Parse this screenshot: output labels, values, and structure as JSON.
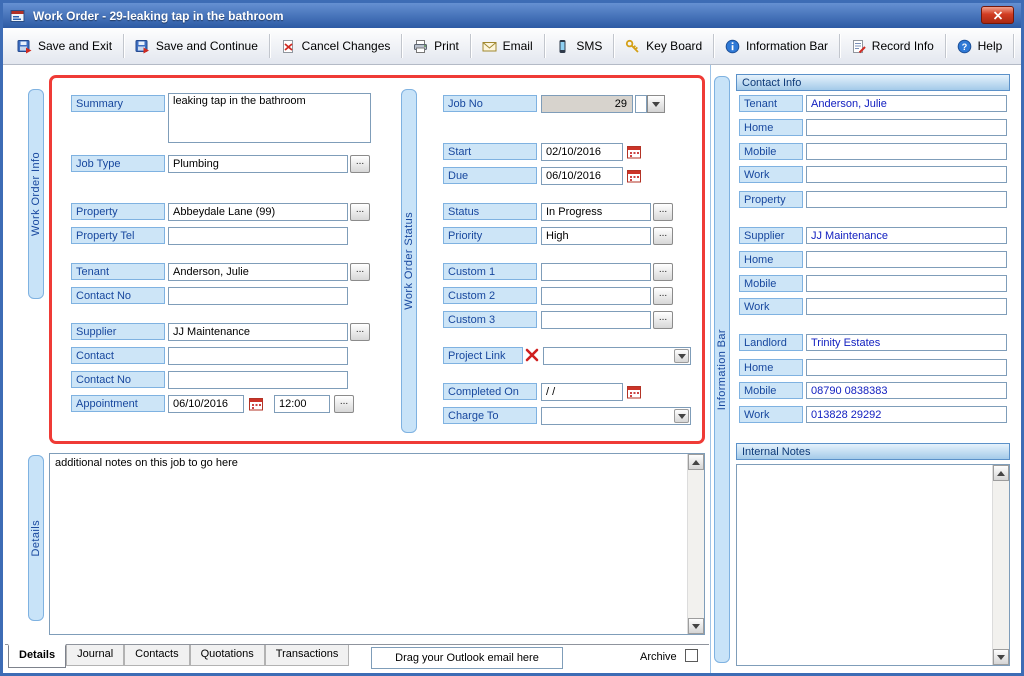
{
  "window": {
    "title": "Work Order -  29-leaking tap in the bathroom"
  },
  "toolbar": {
    "buttons": [
      {
        "label": "Save and Exit"
      },
      {
        "label": "Save and Continue"
      },
      {
        "label": "Cancel Changes"
      },
      {
        "label": "Print"
      },
      {
        "label": "Email"
      },
      {
        "label": "SMS"
      },
      {
        "label": "Key Board"
      },
      {
        "label": "Information Bar"
      },
      {
        "label": "Record Info"
      },
      {
        "label": "Help"
      }
    ]
  },
  "side_tabs": {
    "work_order_info": "Work Order Info",
    "work_order_status": "Work Order Status",
    "details": "Details",
    "information_bar": "Information Bar"
  },
  "work_order_info": {
    "summary_label": "Summary",
    "summary_value": "leaking tap in the bathroom",
    "job_type_label": "Job Type",
    "job_type_value": "Plumbing",
    "property_label": "Property",
    "property_value": "Abbeydale Lane (99)",
    "property_tel_label": "Property Tel",
    "property_tel_value": "",
    "tenant_label": "Tenant",
    "tenant_value": "Anderson, Julie",
    "tenant_contact_no_label": "Contact No",
    "tenant_contact_no_value": "",
    "supplier_label": "Supplier",
    "supplier_value": "JJ Maintenance",
    "contact_label": "Contact",
    "contact_value": "",
    "contact_no_label": "Contact No",
    "contact_no_value": "",
    "appointment_label": "Appointment",
    "appointment_date": "06/10/2016",
    "appointment_time": "12:00"
  },
  "work_order_status": {
    "job_no_label": "Job No",
    "job_no_value": "29",
    "start_label": "Start",
    "start_value": "02/10/2016",
    "due_label": "Due",
    "due_value": "06/10/2016",
    "status_label": "Status",
    "status_value": "In Progress",
    "priority_label": "Priority",
    "priority_value": "High",
    "custom1_label": "Custom 1",
    "custom1_value": "",
    "custom2_label": "Custom 2",
    "custom2_value": "",
    "custom3_label": "Custom 3",
    "custom3_value": "",
    "project_link_label": "Project Link",
    "project_link_value": "",
    "completed_on_label": "Completed On",
    "completed_on_value": "/ /",
    "charge_to_label": "Charge To",
    "charge_to_value": ""
  },
  "details": {
    "notes": "additional notes on this job to go here"
  },
  "bottom_bar": {
    "tabs": [
      {
        "label": "Details"
      },
      {
        "label": "Journal"
      },
      {
        "label": "Contacts"
      },
      {
        "label": "Quotations"
      },
      {
        "label": "Transactions"
      }
    ],
    "active_tab": "Details",
    "outlook_hint": "Drag your Outlook email here",
    "archive_label": "Archive"
  },
  "contact_info": {
    "header": "Contact Info",
    "rows": [
      {
        "label": "Tenant",
        "value": "Anderson, Julie"
      },
      {
        "label": "Home",
        "value": ""
      },
      {
        "label": "Mobile",
        "value": ""
      },
      {
        "label": "Work",
        "value": ""
      },
      {
        "label": "Property",
        "value": ""
      },
      {
        "label": "Supplier",
        "value": "JJ Maintenance"
      },
      {
        "label": "Home",
        "value": ""
      },
      {
        "label": "Mobile",
        "value": ""
      },
      {
        "label": "Work",
        "value": ""
      },
      {
        "label": "Landlord",
        "value": "Trinity Estates"
      },
      {
        "label": "Home",
        "value": ""
      },
      {
        "label": "Mobile",
        "value": "08790 0838383"
      },
      {
        "label": "Work",
        "value": "013828 29292"
      }
    ],
    "internal_notes_header": "Internal Notes",
    "internal_notes": ""
  },
  "ui": {
    "browse_label": "..."
  },
  "icons": {
    "app-icon": "work-order-form",
    "save-exit-icon": "floppy-disk-red-arrow",
    "save-continue-icon": "floppy-disk-red-arrow",
    "cancel-icon": "document-red-x",
    "print-icon": "printer",
    "email-icon": "envelope",
    "sms-icon": "mobile-phone",
    "keyboard-icon": "gold-key",
    "info-icon": "blue-info-circle",
    "record-info-icon": "document-pencil",
    "help-icon": "blue-question-circle",
    "calendar-icon": "red-calendar",
    "clear-icon": "red-x",
    "chevron-down-icon": "down-triangle",
    "close-icon": "white-x"
  },
  "colors": {
    "highlight_border": "#ef3b36",
    "label_bg": "#cde5f7",
    "label_text": "#17479e",
    "sidebar_value_text": "#1320c0",
    "titlebar_blue": "#2c5aa4"
  }
}
